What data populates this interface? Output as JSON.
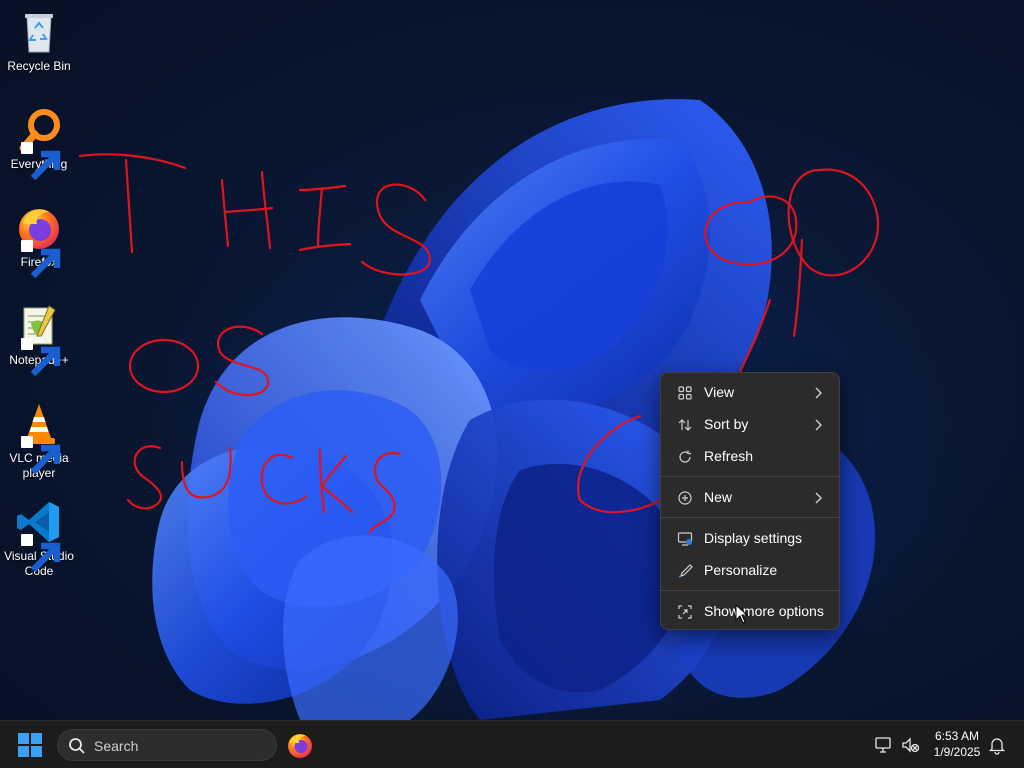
{
  "desktop": {
    "icons": [
      {
        "name": "recycle-bin",
        "label": "Recycle Bin"
      },
      {
        "name": "everything",
        "label": "Everything"
      },
      {
        "name": "firefox",
        "label": "Firefox"
      },
      {
        "name": "notepadpp",
        "label": "Notepad++"
      },
      {
        "name": "vlc",
        "label": "VLC media player"
      },
      {
        "name": "vscode",
        "label": "Visual Studio Code"
      }
    ],
    "annotation_text": "THIS OS SUCKS"
  },
  "context_menu": {
    "items": [
      {
        "label": "View",
        "icon": "grid-view-icon",
        "submenu": true
      },
      {
        "label": "Sort by",
        "icon": "sort-icon",
        "submenu": true
      },
      {
        "label": "Refresh",
        "icon": "refresh-icon",
        "submenu": false
      },
      {
        "label": "New",
        "icon": "plus-circle-icon",
        "submenu": true
      },
      {
        "label": "Display settings",
        "icon": "display-settings-icon",
        "submenu": false
      },
      {
        "label": "Personalize",
        "icon": "brush-icon",
        "submenu": false
      },
      {
        "label": "Show more options",
        "icon": "share-more-icon",
        "submenu": false
      }
    ]
  },
  "taskbar": {
    "search_label": "Search",
    "time": "6:53 AM",
    "date": "1/9/2025"
  },
  "colors": {
    "menu_bg": "#2b2b2b",
    "taskbar_bg": "#1c1c1c",
    "accent": "#0078d4",
    "scribble": "#e0141e"
  }
}
